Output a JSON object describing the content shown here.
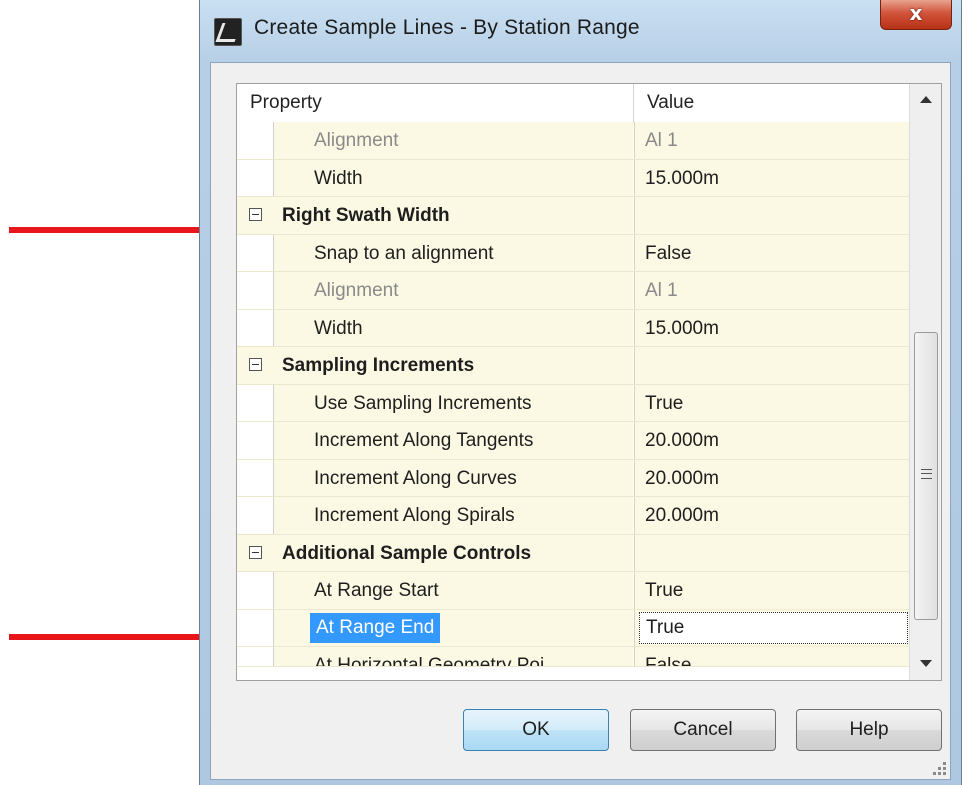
{
  "window": {
    "title": "Create Sample Lines - By Station Range",
    "close_label": "x"
  },
  "grid": {
    "header": {
      "property": "Property",
      "value": "Value"
    },
    "rows": [
      {
        "kind": "item",
        "name": "Alignment",
        "value": "Al 1",
        "disabled": true
      },
      {
        "kind": "item",
        "name": "Width",
        "value": "15.000m"
      },
      {
        "kind": "category",
        "name": "Right Swath Width",
        "value": ""
      },
      {
        "kind": "item",
        "name": "Snap to an alignment",
        "value": "False"
      },
      {
        "kind": "item",
        "name": "Alignment",
        "value": "Al 1",
        "disabled": true
      },
      {
        "kind": "item",
        "name": "Width",
        "value": "15.000m"
      },
      {
        "kind": "category",
        "name": "Sampling Increments",
        "value": ""
      },
      {
        "kind": "item",
        "name": "Use Sampling Increments",
        "value": "True"
      },
      {
        "kind": "item",
        "name": "Increment Along Tangents",
        "value": "20.000m"
      },
      {
        "kind": "item",
        "name": "Increment Along Curves",
        "value": "20.000m"
      },
      {
        "kind": "item",
        "name": "Increment Along Spirals",
        "value": "20.000m"
      },
      {
        "kind": "category",
        "name": "Additional Sample Controls",
        "value": ""
      },
      {
        "kind": "item",
        "name": "At Range Start",
        "value": "True"
      },
      {
        "kind": "item",
        "name": "At Range End",
        "value": "True",
        "selected": true
      },
      {
        "kind": "item",
        "name": "At Horizontal Geometry Poi",
        "value": "False",
        "cut": true
      }
    ]
  },
  "buttons": {
    "ok": "OK",
    "cancel": "Cancel",
    "help": "Help"
  },
  "colors": {
    "annotation_arrow": "#e8161b",
    "selection": "#3399ff",
    "row_fill": "#fbf9e4"
  }
}
